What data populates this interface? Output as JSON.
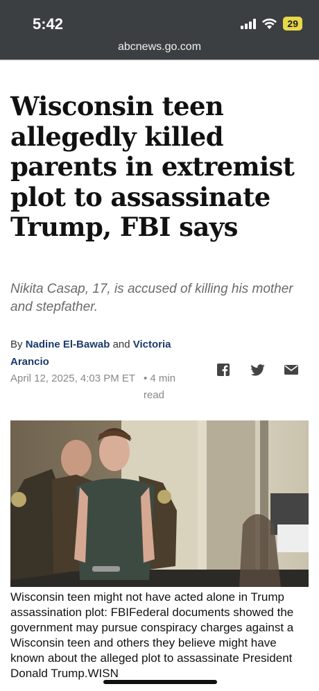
{
  "status_bar": {
    "time": "5:42",
    "battery": "29",
    "signal_icon": "cellular-signal-icon",
    "wifi_icon": "wifi-icon"
  },
  "browser": {
    "url": "abcnews.go.com"
  },
  "article": {
    "headline": "Wisconsin teen allegedly killed parents in extremist plot to assassinate Trump, FBI says",
    "subheadline": "Nikita Casap, 17, is accused of killing his mother and stepfather.",
    "byline_prefix": "By",
    "author_1": "Nadine El-Bawab",
    "byline_and": "and",
    "author_2": "Victoria Arancio",
    "date": "April 12, 2025, 4:03 PM ET",
    "read_time": "• 4 min read",
    "share_icons": [
      "facebook-icon",
      "twitter-icon",
      "email-icon"
    ],
    "photo_caption": "Wisconsin teen might not have acted alone in Trump assassination plot: FBIFederal documents showed the government may pursue conspiracy charges against a Wisconsin teen and others they believe might have known about the alleged plot to assassinate President Donald Trump.WISN"
  },
  "colors": {
    "status_bar_bg": "#3c3f41",
    "author_link": "#1a3a6b",
    "battery": "#e8d84a"
  }
}
